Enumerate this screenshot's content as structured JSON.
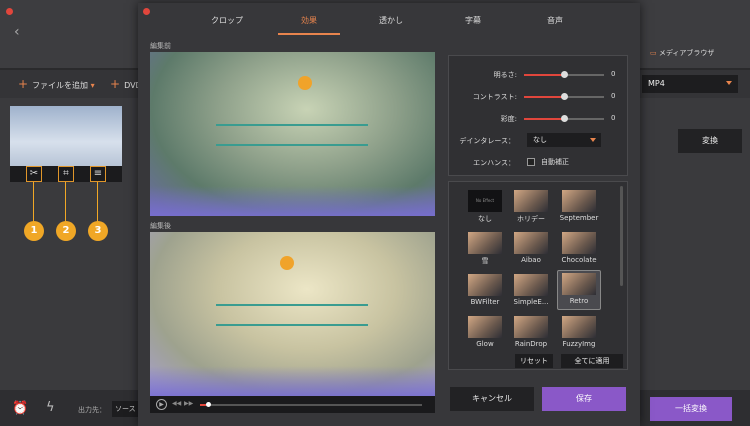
{
  "background": {
    "add_file_label": "ファイルを追加",
    "dvd_label": "DVD",
    "media_browser_label": "メディアブラウザ",
    "output_format": "MP4",
    "convert_label": "変換",
    "output_label": "出力先：",
    "output_value": "ソース",
    "batch_convert_label": "一括変換",
    "thumb_icons": [
      "cut-icon",
      "crop-icon",
      "effects-icon"
    ],
    "markers": [
      "1",
      "2",
      "3"
    ],
    "marker_color": "#f0a726"
  },
  "dialog": {
    "tabs": [
      {
        "label": "クロップ",
        "active": false
      },
      {
        "label": "効果",
        "active": true
      },
      {
        "label": "透かし",
        "active": false
      },
      {
        "label": "字幕",
        "active": false
      },
      {
        "label": "音声",
        "active": false
      }
    ],
    "before_label": "編集前",
    "after_label": "編集後",
    "adjustments": {
      "brightness": {
        "label": "明るさ:",
        "value": "0"
      },
      "contrast": {
        "label": "コントラスト:",
        "value": "0"
      },
      "saturation": {
        "label": "彩度:",
        "value": "0"
      },
      "deinterlace": {
        "label": "デインタレース：",
        "value": "なし"
      },
      "enhance": {
        "label": "エンハンス：",
        "checkbox_label": "自動補正",
        "checked": false
      }
    },
    "filters": [
      {
        "name": "なし",
        "thumb_text": "No Effect",
        "selected": false
      },
      {
        "name": "ホリデー",
        "selected": false
      },
      {
        "name": "September",
        "selected": false
      },
      {
        "name": "雪",
        "selected": false
      },
      {
        "name": "Aibao",
        "selected": false
      },
      {
        "name": "Chocolate",
        "selected": false
      },
      {
        "name": "BWFilter",
        "selected": false
      },
      {
        "name": "SimpleE...",
        "selected": false
      },
      {
        "name": "Retro",
        "selected": true
      },
      {
        "name": "Glow",
        "selected": false
      },
      {
        "name": "RainDrop",
        "selected": false
      },
      {
        "name": "FuzzyImg",
        "selected": false
      }
    ],
    "reset_label": "リセット",
    "apply_all_label": "全てに適用",
    "cancel_label": "キャンセル",
    "save_label": "保存",
    "accent_color": "#e8844d",
    "save_color": "#8a58c8"
  }
}
